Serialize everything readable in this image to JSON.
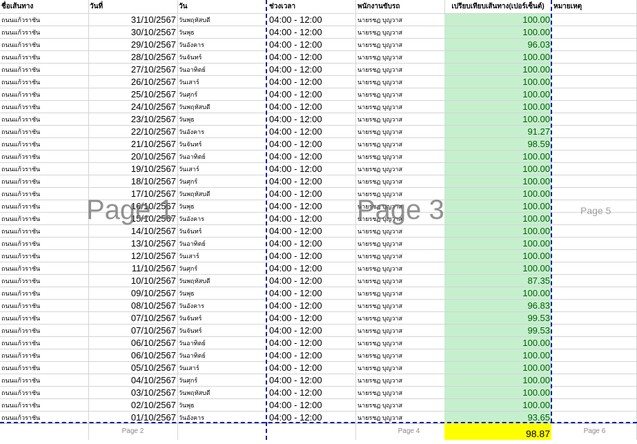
{
  "headers": {
    "route": "ชื่อเส้นทาง",
    "date": "วันที่",
    "day": "วัน",
    "time": "ช่วงเวลา",
    "driver": "พนักงานขับรถ",
    "percent": "เปรียบเทียบเส้นทาง(เปอร์เซ็นต์)",
    "note": "หมายเหตุ"
  },
  "rows": [
    {
      "route": "ถนนแก้วราชัน",
      "date": "31/10/2567",
      "day": "วันพฤหัสบดี",
      "time": "04:00 - 12:00",
      "driver": "นายรชฏ บุญวาส",
      "percent": "100.00"
    },
    {
      "route": "ถนนแก้วราชัน",
      "date": "30/10/2567",
      "day": "วันพุธ",
      "time": "04:00 - 12:00",
      "driver": "นายรชฏ บุญวาส",
      "percent": "100.00"
    },
    {
      "route": "ถนนแก้วราชัน",
      "date": "29/10/2567",
      "day": "วันอังคาร",
      "time": "04:00 - 12:00",
      "driver": "นายรชฏ บุญวาส",
      "percent": "96.03"
    },
    {
      "route": "ถนนแก้วราชัน",
      "date": "28/10/2567",
      "day": "วันจันทร์",
      "time": "04:00 - 12:00",
      "driver": "นายรชฏ บุญวาส",
      "percent": "100.00"
    },
    {
      "route": "ถนนแก้วราชัน",
      "date": "27/10/2567",
      "day": "วันอาทิตย์",
      "time": "04:00 - 12:00",
      "driver": "นายรชฏ บุญวาส",
      "percent": "100.00"
    },
    {
      "route": "ถนนแก้วราชัน",
      "date": "26/10/2567",
      "day": "วันเสาร์",
      "time": "04:00 - 12:00",
      "driver": "นายรชฏ บุญวาส",
      "percent": "100.00"
    },
    {
      "route": "ถนนแก้วราชัน",
      "date": "25/10/2567",
      "day": "วันศุกร์",
      "time": "04:00 - 12:00",
      "driver": "นายรชฏ บุญวาส",
      "percent": "100.00"
    },
    {
      "route": "ถนนแก้วราชัน",
      "date": "24/10/2567",
      "day": "วันพฤหัสบดี",
      "time": "04:00 - 12:00",
      "driver": "นายรชฏ บุญวาส",
      "percent": "100.00"
    },
    {
      "route": "ถนนแก้วราชัน",
      "date": "23/10/2567",
      "day": "วันพุธ",
      "time": "04:00 - 12:00",
      "driver": "นายรชฏ บุญวาส",
      "percent": "100.00"
    },
    {
      "route": "ถนนแก้วราชัน",
      "date": "22/10/2567",
      "day": "วันอังคาร",
      "time": "04:00 - 12:00",
      "driver": "นายรชฏ บุญวาส",
      "percent": "91.27"
    },
    {
      "route": "ถนนแก้วราชัน",
      "date": "21/10/2567",
      "day": "วันจันทร์",
      "time": "04:00 - 12:00",
      "driver": "นายรชฏ บุญวาส",
      "percent": "98.59"
    },
    {
      "route": "ถนนแก้วราชัน",
      "date": "20/10/2567",
      "day": "วันอาทิตย์",
      "time": "04:00 - 12:00",
      "driver": "นายรชฏ บุญวาส",
      "percent": "100.00"
    },
    {
      "route": "ถนนแก้วราชัน",
      "date": "19/10/2567",
      "day": "วันเสาร์",
      "time": "04:00 - 12:00",
      "driver": "นายรชฏ บุญวาส",
      "percent": "100.00"
    },
    {
      "route": "ถนนแก้วราชัน",
      "date": "18/10/2567",
      "day": "วันศุกร์",
      "time": "04:00 - 12:00",
      "driver": "นายรชฏ บุญวาส",
      "percent": "100.00"
    },
    {
      "route": "ถนนแก้วราชัน",
      "date": "17/10/2567",
      "day": "วันพฤหัสบดี",
      "time": "04:00 - 12:00",
      "driver": "นายรชฏ บุญวาส",
      "percent": "100.00"
    },
    {
      "route": "ถนนแก้วราชัน",
      "date": "16/10/2567",
      "day": "วันพุธ",
      "time": "04:00 - 12:00",
      "driver": "นายรชฏ บุญวาส",
      "percent": "100.00"
    },
    {
      "route": "ถนนแก้วราชัน",
      "date": "15/10/2567",
      "day": "วันอังคาร",
      "time": "04:00 - 12:00",
      "driver": "นายรชฏ บุญวาส",
      "percent": "100.00"
    },
    {
      "route": "ถนนแก้วราชัน",
      "date": "14/10/2567",
      "day": "วันจันทร์",
      "time": "04:00 - 12:00",
      "driver": "นายรชฏ บุญวาส",
      "percent": "100.00"
    },
    {
      "route": "ถนนแก้วราชัน",
      "date": "13/10/2567",
      "day": "วันอาทิตย์",
      "time": "04:00 - 12:00",
      "driver": "นายรชฏ บุญวาส",
      "percent": "100.00"
    },
    {
      "route": "ถนนแก้วราชัน",
      "date": "12/10/2567",
      "day": "วันเสาร์",
      "time": "04:00 - 12:00",
      "driver": "นายรชฏ บุญวาส",
      "percent": "100.00"
    },
    {
      "route": "ถนนแก้วราชัน",
      "date": "11/10/2567",
      "day": "วันศุกร์",
      "time": "04:00 - 12:00",
      "driver": "นายรชฏ บุญวาส",
      "percent": "100.00"
    },
    {
      "route": "ถนนแก้วราชัน",
      "date": "10/10/2567",
      "day": "วันพฤหัสบดี",
      "time": "04:00 - 12:00",
      "driver": "นายรชฏ บุญวาส",
      "percent": "87.35"
    },
    {
      "route": "ถนนแก้วราชัน",
      "date": "09/10/2567",
      "day": "วันพุธ",
      "time": "04:00 - 12:00",
      "driver": "นายรชฏ บุญวาส",
      "percent": "100.00"
    },
    {
      "route": "ถนนแก้วราชัน",
      "date": "08/10/2567",
      "day": "วันอังคาร",
      "time": "04:00 - 12:00",
      "driver": "นายรชฏ บุญวาส",
      "percent": "96.83"
    },
    {
      "route": "ถนนแก้วราชัน",
      "date": "07/10/2567",
      "day": "วันจันทร์",
      "time": "04:00 - 12:00",
      "driver": "นายรชฏ บุญวาส",
      "percent": "99.53"
    },
    {
      "route": "ถนนแก้วราชัน",
      "date": "07/10/2567",
      "day": "วันจันทร์",
      "time": "04:00 - 12:00",
      "driver": "นายรชฏ บุญวาส",
      "percent": "99.53"
    },
    {
      "route": "ถนนแก้วราชัน",
      "date": "06/10/2567",
      "day": "วันอาทิตย์",
      "time": "04:00 - 12:00",
      "driver": "นายรชฏ บุญวาส",
      "percent": "100.00"
    },
    {
      "route": "ถนนแก้วราชัน",
      "date": "06/10/2567",
      "day": "วันอาทิตย์",
      "time": "04:00 - 12:00",
      "driver": "นายรชฏ บุญวาส",
      "percent": "100.00"
    },
    {
      "route": "ถนนแก้วราชัน",
      "date": "05/10/2567",
      "day": "วันเสาร์",
      "time": "04:00 - 12:00",
      "driver": "นายรชฏ บุญวาส",
      "percent": "100.00"
    },
    {
      "route": "ถนนแก้วราชัน",
      "date": "04/10/2567",
      "day": "วันศุกร์",
      "time": "04:00 - 12:00",
      "driver": "นายรชฏ บุญวาส",
      "percent": "100.00"
    },
    {
      "route": "ถนนแก้วราชัน",
      "date": "03/10/2567",
      "day": "วันพฤหัสบดี",
      "time": "04:00 - 12:00",
      "driver": "นายรชฏ บุญวาส",
      "percent": "100.00"
    },
    {
      "route": "ถนนแก้วราชัน",
      "date": "02/10/2567",
      "day": "วันพุธ",
      "time": "04:00 - 12:00",
      "driver": "นายรชฏ บุญวาส",
      "percent": "100.00"
    },
    {
      "route": "ถนนแก้วราชัน",
      "date": "01/10/2567",
      "day": "วันอังคาร",
      "time": "04:00 - 12:00",
      "driver": "นายรชฏ บุญวาส",
      "percent": "93.65"
    }
  ],
  "total": "98.87",
  "watermarks": {
    "page1": "Page 1",
    "page3": "Page 3",
    "page5": "Page 5"
  },
  "footer_pages": {
    "page2": "Page 2",
    "page4": "Page 4",
    "page6": "Page 6"
  },
  "colors": {
    "percent_fill": "#c6efce",
    "percent_text": "#006100",
    "total_fill": "#ffff00",
    "page_break": "#0a1f9e"
  }
}
